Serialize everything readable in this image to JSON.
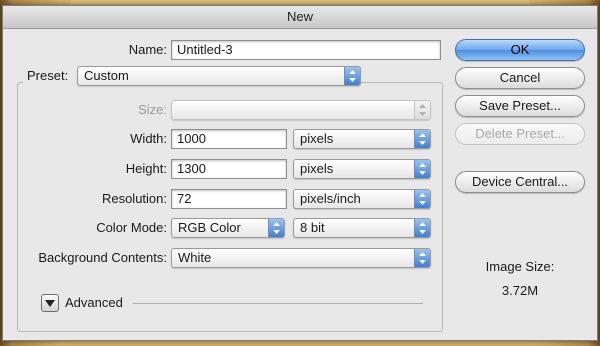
{
  "window": {
    "title": "New"
  },
  "form": {
    "name_label": "Name:",
    "name_value": "Untitled-3",
    "preset_label": "Preset:",
    "preset_value": "Custom",
    "size_label": "Size:",
    "size_value": "",
    "width_label": "Width:",
    "width_value": "1000",
    "width_unit": "pixels",
    "height_label": "Height:",
    "height_value": "1300",
    "height_unit": "pixels",
    "resolution_label": "Resolution:",
    "resolution_value": "72",
    "resolution_unit": "pixels/inch",
    "color_mode_label": "Color Mode:",
    "color_mode_value": "RGB Color",
    "bit_depth_value": "8 bit",
    "background_label": "Background Contents:",
    "background_value": "White",
    "advanced_label": "Advanced"
  },
  "buttons": {
    "ok": "OK",
    "cancel": "Cancel",
    "save_preset": "Save Preset...",
    "delete_preset": "Delete Preset...",
    "device_central": "Device Central..."
  },
  "info": {
    "image_size_label": "Image Size:",
    "image_size_value": "3.72M"
  },
  "colors": {
    "accent": "#4c8fe4",
    "dialog_bg": "#e8e8e8",
    "disabled_text": "#9a9a9a"
  }
}
